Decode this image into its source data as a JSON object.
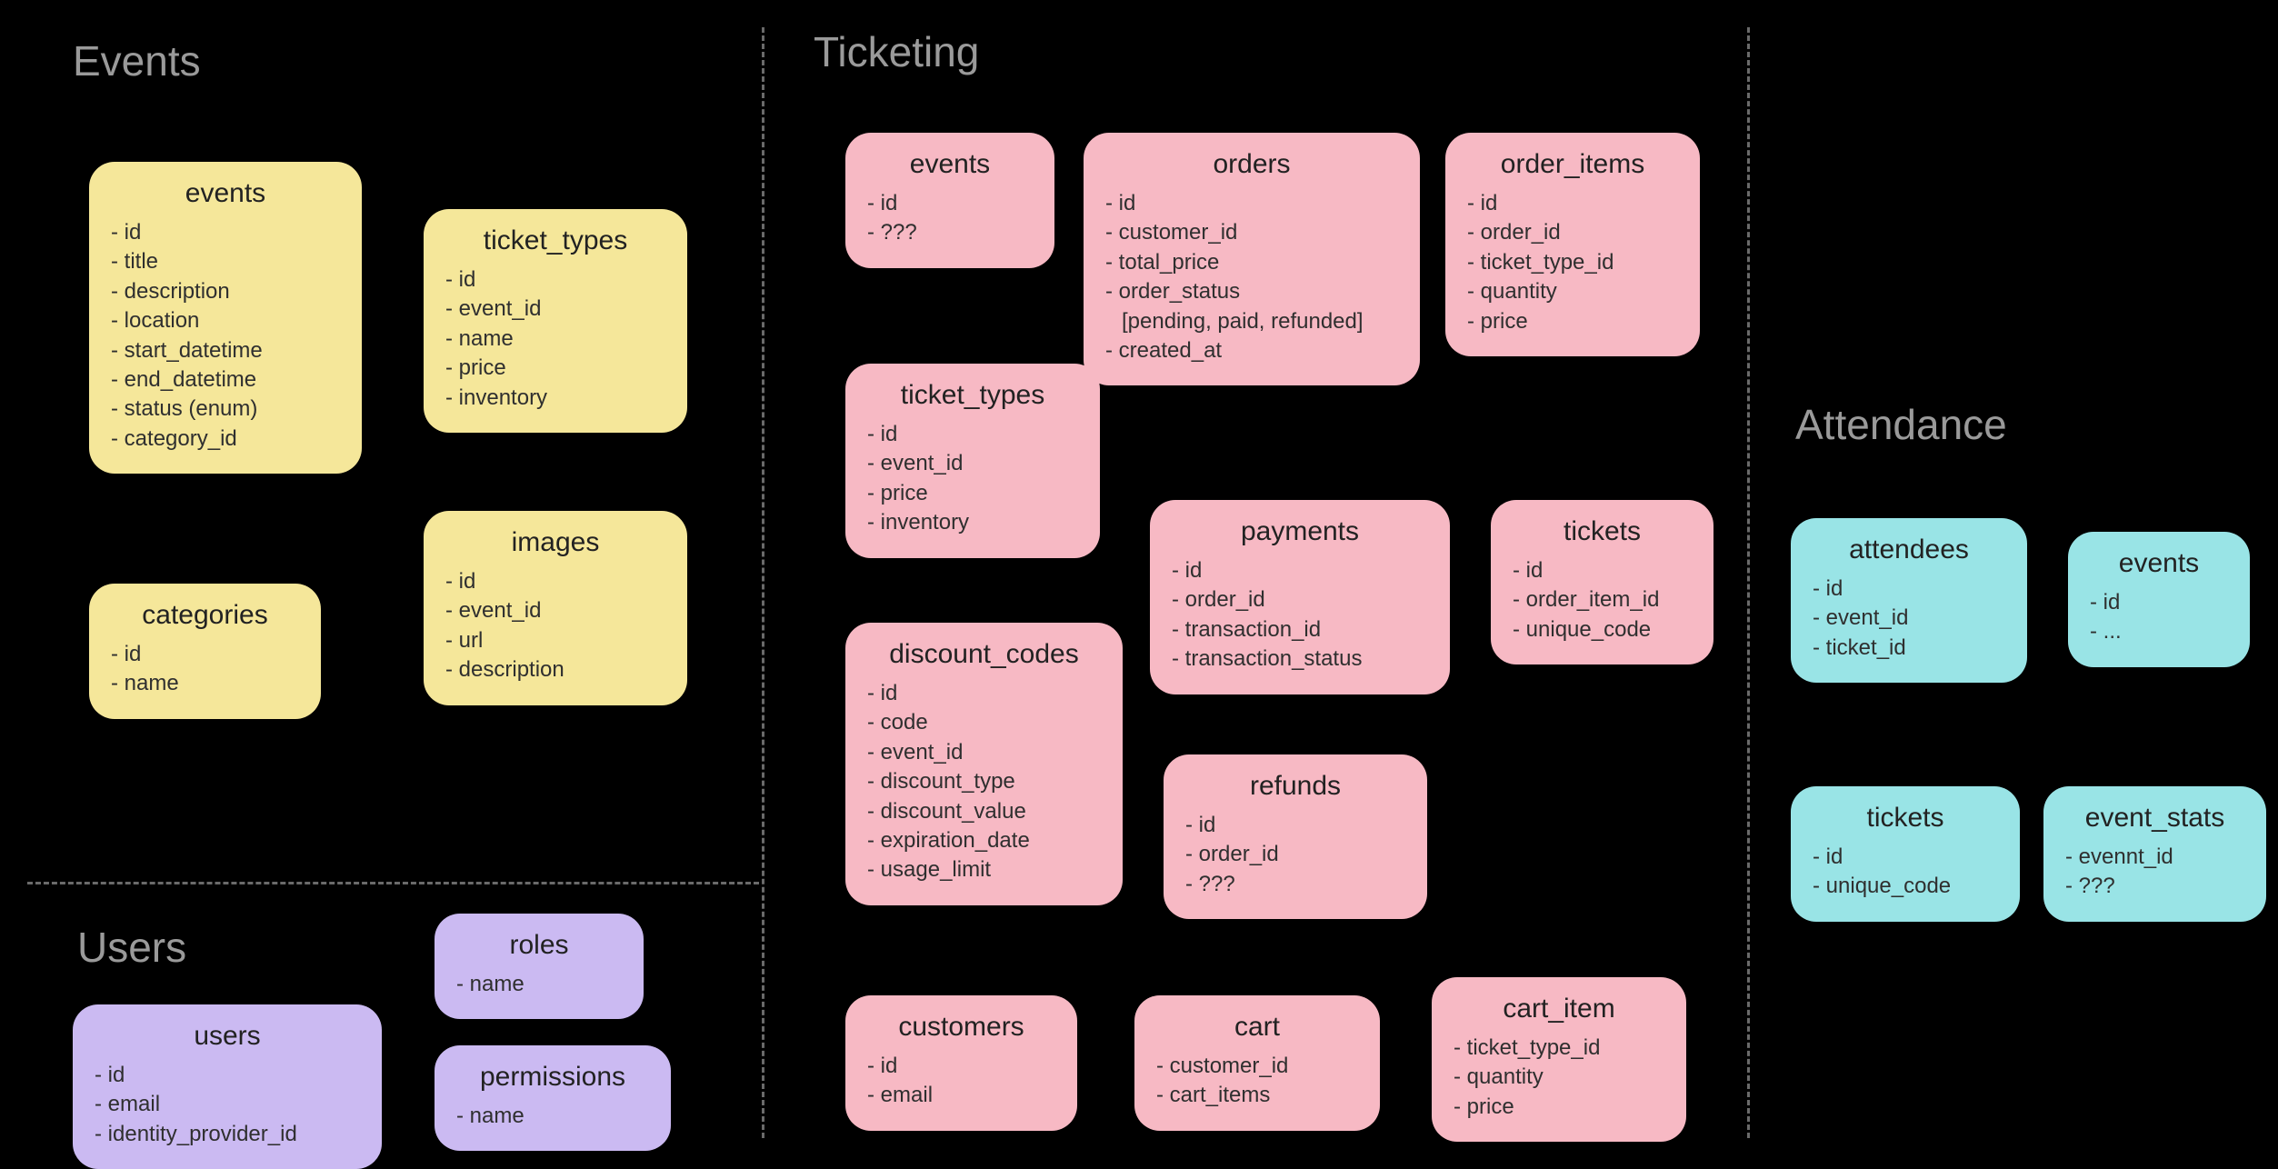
{
  "sections": {
    "events": "Events",
    "users": "Users",
    "ticketing": "Ticketing",
    "attendance": "Attendance"
  },
  "events": {
    "events": {
      "title": "events",
      "fields": [
        "id",
        "title",
        "description",
        "location",
        "start_datetime",
        "end_datetime",
        "status (enum)",
        "category_id"
      ]
    },
    "categories": {
      "title": "categories",
      "fields": [
        "id",
        "name"
      ]
    },
    "ticket_types": {
      "title": "ticket_types",
      "fields": [
        "id",
        "event_id",
        "name",
        "price",
        "inventory"
      ]
    },
    "images": {
      "title": "images",
      "fields": [
        "id",
        "event_id",
        "url",
        "description"
      ]
    }
  },
  "users": {
    "users": {
      "title": "users",
      "fields": [
        "id",
        "email",
        "identity_provider_id"
      ]
    },
    "roles": {
      "title": "roles",
      "fields": [
        "name"
      ]
    },
    "permissions": {
      "title": "permissions",
      "fields": [
        "name"
      ]
    }
  },
  "ticketing": {
    "events": {
      "title": "events",
      "fields": [
        "id",
        "???"
      ]
    },
    "orders": {
      "title": "orders",
      "fields": [
        "id",
        "customer_id",
        "total_price",
        "order_status",
        "[pending, paid, refunded]",
        "created_at"
      ]
    },
    "order_items": {
      "title": "order_items",
      "fields": [
        "id",
        "order_id",
        "ticket_type_id",
        "quantity",
        "price"
      ]
    },
    "ticket_types": {
      "title": "ticket_types",
      "fields": [
        "id",
        "event_id",
        "price",
        "inventory"
      ]
    },
    "payments": {
      "title": "payments",
      "fields": [
        "id",
        "order_id",
        "transaction_id",
        "transaction_status"
      ]
    },
    "tickets": {
      "title": "tickets",
      "fields": [
        "id",
        "order_item_id",
        "unique_code"
      ]
    },
    "discount_codes": {
      "title": "discount_codes",
      "fields": [
        "id",
        "code",
        "event_id",
        "discount_type",
        "discount_value",
        "expiration_date",
        "usage_limit"
      ]
    },
    "refunds": {
      "title": "refunds",
      "fields": [
        "id",
        "order_id",
        "???"
      ]
    },
    "customers": {
      "title": "customers",
      "fields": [
        "id",
        "email"
      ]
    },
    "cart": {
      "title": "cart",
      "fields": [
        "customer_id",
        "cart_items"
      ]
    },
    "cart_item": {
      "title": "cart_item",
      "fields": [
        "ticket_type_id",
        "quantity",
        "price"
      ]
    }
  },
  "attendance": {
    "attendees": {
      "title": "attendees",
      "fields": [
        "id",
        "event_id",
        "ticket_id"
      ]
    },
    "events": {
      "title": "events",
      "fields": [
        "id",
        "..."
      ]
    },
    "tickets": {
      "title": "tickets",
      "fields": [
        "id",
        "unique_code"
      ]
    },
    "event_stats": {
      "title": "event_stats",
      "fields": [
        "evennt_id",
        "???"
      ]
    }
  }
}
